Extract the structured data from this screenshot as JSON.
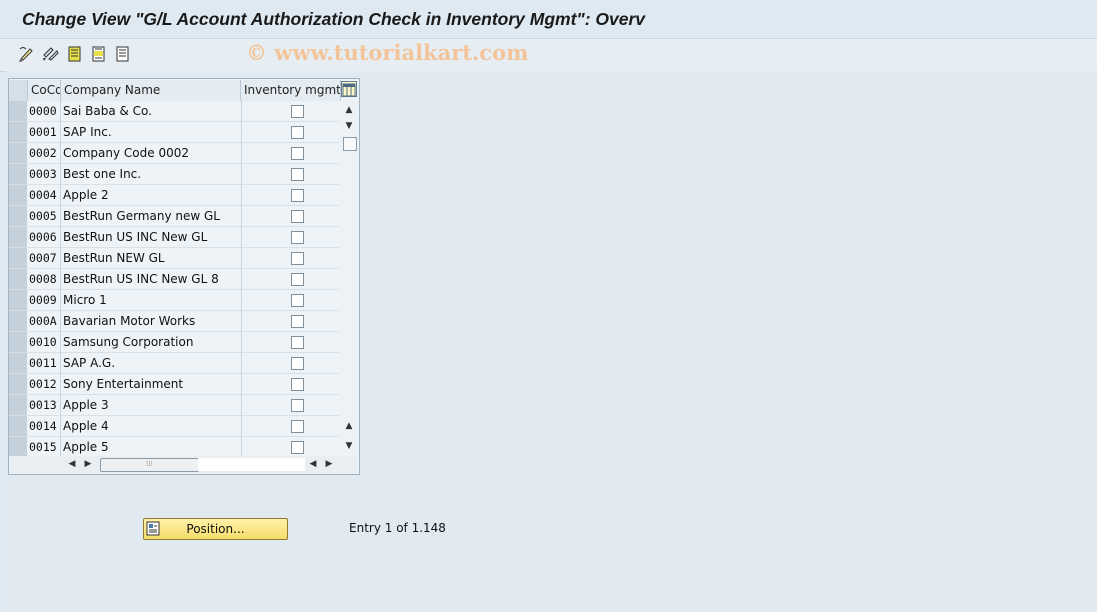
{
  "window": {
    "title": "Change View \"G/L Account Authorization Check in Inventory Mgmt\": Overv"
  },
  "toolbar": {
    "icons": [
      "display-change-icon",
      "other-view-icon",
      "select-all-icon",
      "select-block-icon",
      "deselect-all-icon"
    ]
  },
  "watermark": "© www.tutorialkart.com",
  "table": {
    "columns": [
      "CoCd",
      "Company Name",
      "Inventory mgmt"
    ],
    "rows": [
      {
        "code": "0000",
        "name": "Sai Baba & Co.",
        "inventory_mgmt": false
      },
      {
        "code": "0001",
        "name": "SAP Inc.",
        "inventory_mgmt": false
      },
      {
        "code": "0002",
        "name": "Company Code 0002",
        "inventory_mgmt": false
      },
      {
        "code": "0003",
        "name": "Best one Inc.",
        "inventory_mgmt": false
      },
      {
        "code": "0004",
        "name": "Apple 2",
        "inventory_mgmt": false
      },
      {
        "code": "0005",
        "name": "BestRun Germany new GL",
        "inventory_mgmt": false
      },
      {
        "code": "0006",
        "name": "BestRun US INC New GL",
        "inventory_mgmt": false
      },
      {
        "code": "0007",
        "name": "BestRun NEW GL",
        "inventory_mgmt": false
      },
      {
        "code": "0008",
        "name": "BestRun US INC New GL 8",
        "inventory_mgmt": false
      },
      {
        "code": "0009",
        "name": "Micro 1",
        "inventory_mgmt": false
      },
      {
        "code": "000A",
        "name": "Bavarian Motor Works",
        "inventory_mgmt": false
      },
      {
        "code": "0010",
        "name": "Samsung Corporation",
        "inventory_mgmt": false
      },
      {
        "code": "0011",
        "name": "SAP A.G.",
        "inventory_mgmt": false
      },
      {
        "code": "0012",
        "name": "Sony Entertainment",
        "inventory_mgmt": false
      },
      {
        "code": "0013",
        "name": "Apple 3",
        "inventory_mgmt": false
      },
      {
        "code": "0014",
        "name": "Apple 4",
        "inventory_mgmt": false
      },
      {
        "code": "0015",
        "name": "Apple 5",
        "inventory_mgmt": false
      }
    ]
  },
  "footer": {
    "position_button": "Position...",
    "entry_text": "Entry 1 of 1.148"
  },
  "colors": {
    "background": "#dfe9f1",
    "button_yellow": "#f5dc6a",
    "watermark": "#f3c49a"
  }
}
